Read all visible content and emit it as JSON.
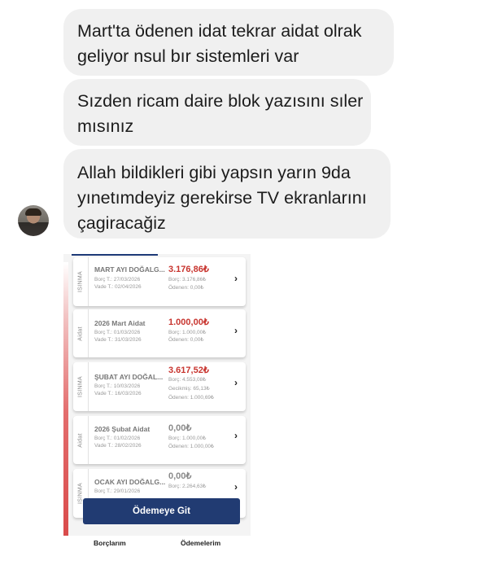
{
  "messages": [
    {
      "lines": [
        "Mart'ta ödenen idat tekrar aidat olrak",
        "geliyor nsul bır sistemleri var"
      ]
    },
    {
      "lines": [
        "Sızden ricam daire blok yazısını sıler",
        "mısınız"
      ]
    },
    {
      "lines": [
        "Allah bildikleri gibi yapsın yarın 9da",
        "yınetımdeyiz gerekirse TV ekranlarını",
        "çagiracağiz"
      ]
    }
  ],
  "app": {
    "cards": [
      {
        "category": "ISINMA",
        "title": "MART AYI DOĞALG...",
        "borc_t": "Borç T.: 27/03/2026",
        "vade_t": "Vade T.: 02/04/2026",
        "amount": "3.176,86₺",
        "amount_color": "#c8352f",
        "borc": "Borç: 3.176,86₺",
        "gecikmis": "",
        "odenen": "Ödenen: 0,00₺"
      },
      {
        "category": "Aidat",
        "title": "2026 Mart Aidat",
        "borc_t": "Borç T.: 01/03/2026",
        "vade_t": "Vade T.: 31/03/2026",
        "amount": "1.000,00₺",
        "amount_color": "#c8352f",
        "borc": "Borç: 1.000,00₺",
        "gecikmis": "",
        "odenen": "Ödenen: 0,00₺"
      },
      {
        "category": "ISINMA",
        "title": "ŞUBAT AYI DOĞAL...",
        "borc_t": "Borç T.: 10/03/2026",
        "vade_t": "Vade T.: 16/03/2026",
        "amount": "3.617,52₺",
        "amount_color": "#c8352f",
        "borc": "Borç: 4.553,08₺",
        "gecikmis": "Gecikmiş: 65,13₺",
        "odenen": "Ödenen: 1.000,69₺"
      },
      {
        "category": "Aidat",
        "title": "2026 Şubat Aidat",
        "borc_t": "Borç T.: 01/02/2026",
        "vade_t": "Vade T.: 28/02/2026",
        "amount": "0,00₺",
        "amount_color": "#8a8a8a",
        "borc": "Borç: 1.000,00₺",
        "gecikmis": "",
        "odenen": "Ödenen: 1.000,00₺"
      },
      {
        "category": "ISINMA",
        "title": "OCAK AYI DOĞALG...",
        "borc_t": "Borç T.: 29/01/2026",
        "vade_t": "",
        "amount": "0,00₺",
        "amount_color": "#8a8a8a",
        "borc": "Borç: 2.264,63₺",
        "gecikmis": "",
        "odenen": ""
      }
    ],
    "pay_button": "Ödemeye Git",
    "tabs": [
      "Borçlarım",
      "Ödemelerim"
    ]
  }
}
